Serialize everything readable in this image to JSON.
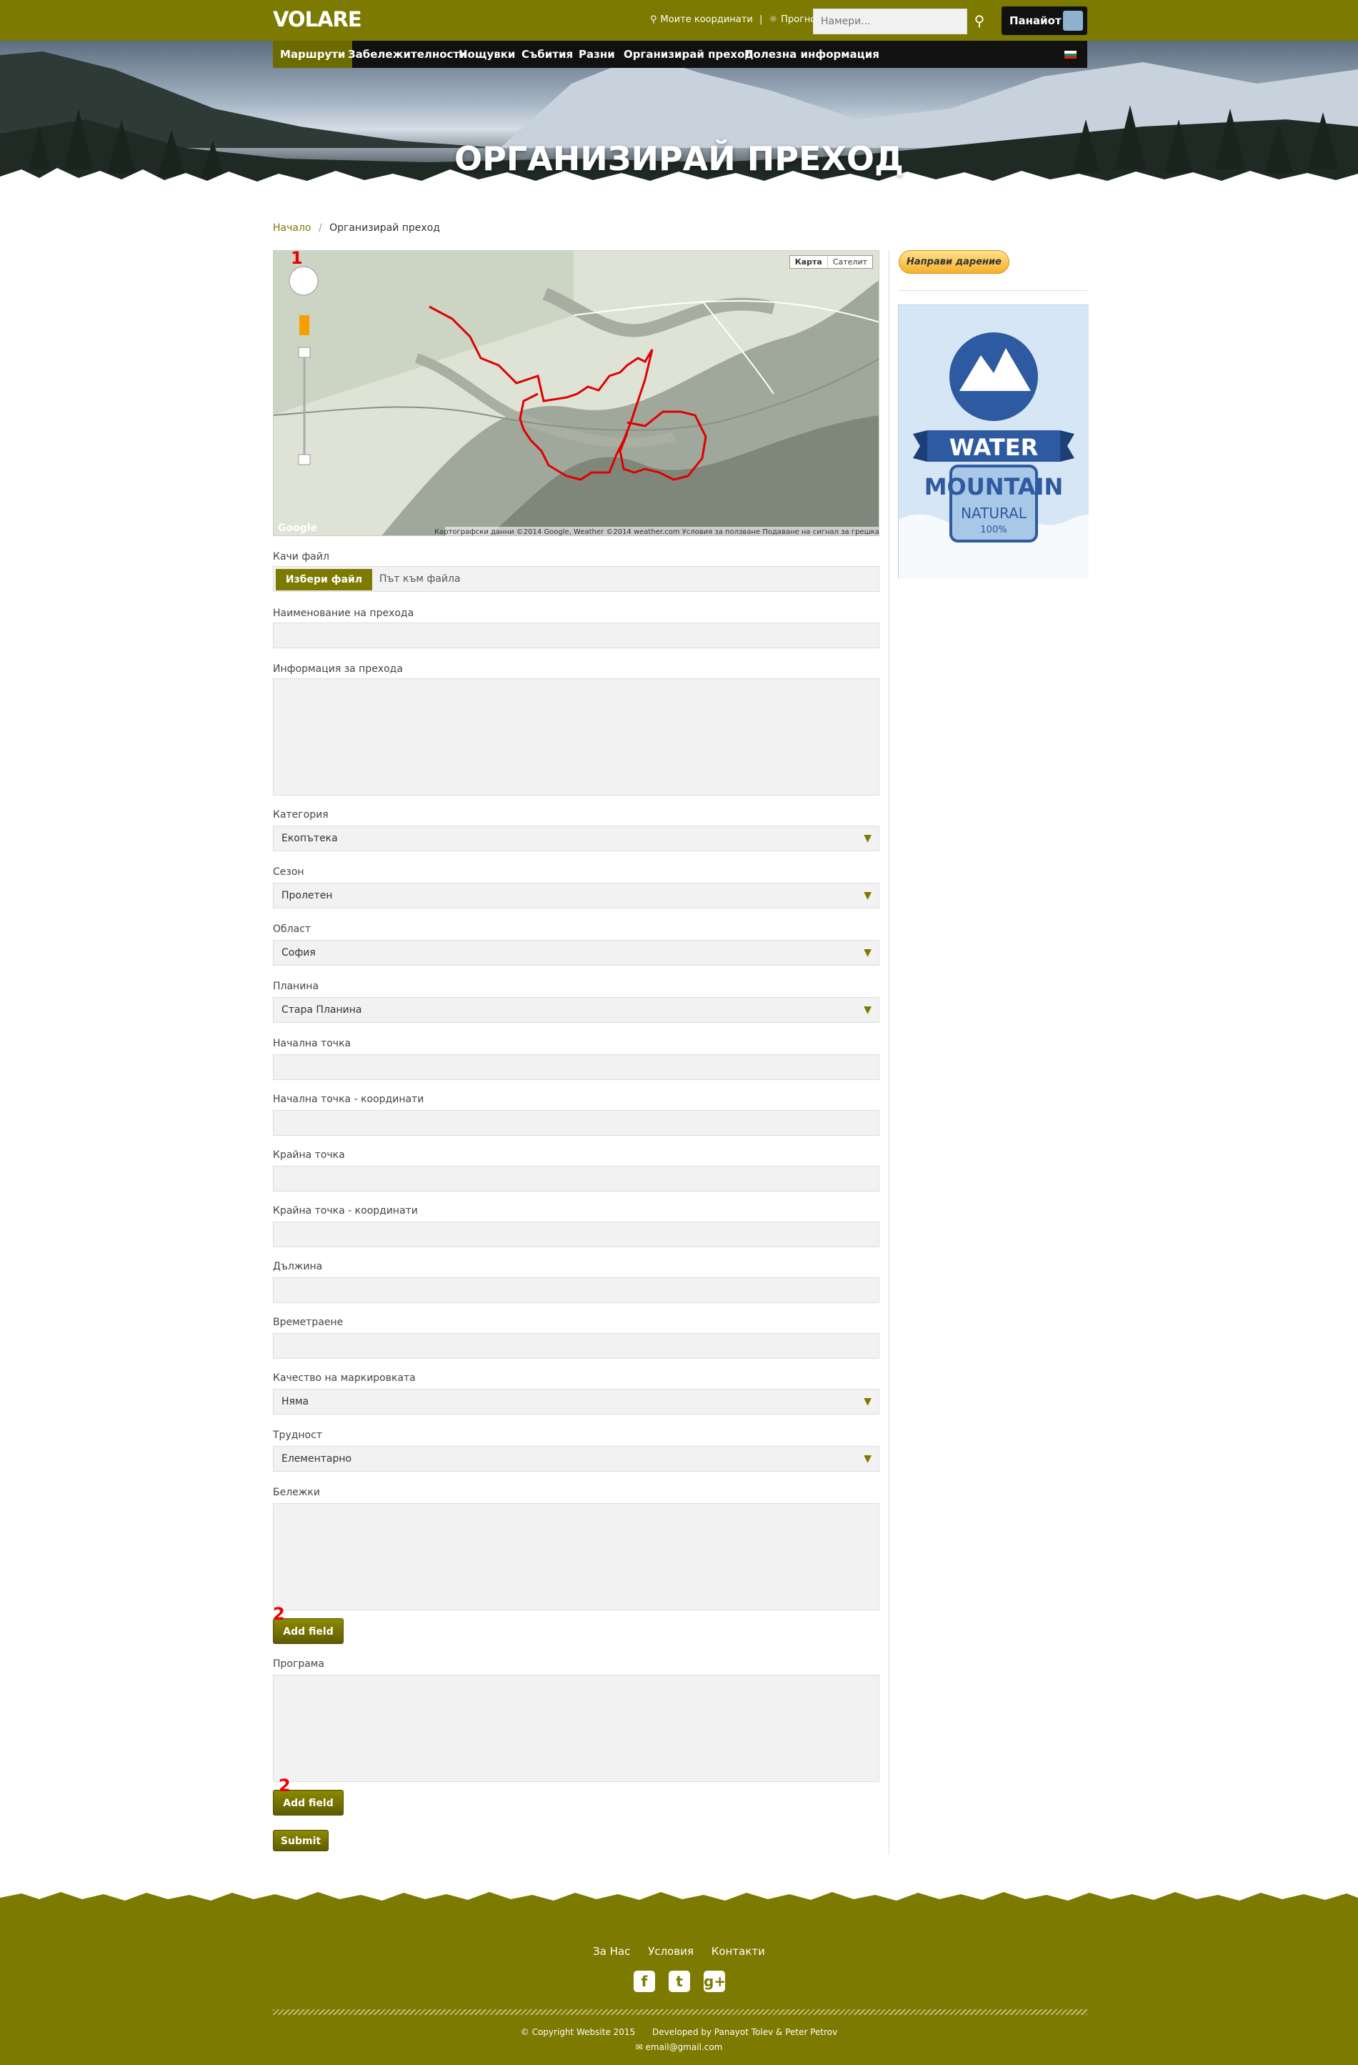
{
  "header": {
    "logo": "VOLARE",
    "coords_link": "Моите координати",
    "separator": "|",
    "forecast_link": "Прогноза",
    "search_placeholder": "Намери...",
    "user_name": "Панайот"
  },
  "nav": {
    "items": [
      "Маршрути",
      "Забележителности",
      "Нощувки",
      "Събития",
      "Разни",
      "Организирай преход",
      "Полезна информация"
    ],
    "active_index": 0
  },
  "hero": {
    "title": "ОРГАНИЗИРАЙ ПРЕХОД"
  },
  "breadcrumb": {
    "home": "Начало",
    "sep": "/",
    "current": "Организирай преход"
  },
  "map": {
    "type_buttons": [
      "Карта",
      "Сателит"
    ],
    "marker": "1",
    "google": "Google",
    "attribution": "Картографски данни ©2014 Google, Weather ©2014 weather.com   Условия за ползване   Подаване на сигнал за грешка в картата"
  },
  "form": {
    "upload_label": "Качи файл",
    "upload_button": "Избери файл",
    "upload_path": "Път към файла",
    "name_label": "Наименование на прехода",
    "info_label": "Информация за прехода",
    "category_label": "Категория",
    "category_value": "Екопътека",
    "season_label": "Сезон",
    "season_value": "Пролетен",
    "region_label": "Област",
    "region_value": "София",
    "mountain_label": "Планина",
    "mountain_value": "Стара Планина",
    "start_label": "Начална точка",
    "start_coords_label": "Начална точка - координати",
    "end_label": "Крайна точка",
    "end_coords_label": "Крайна точка - координати",
    "length_label": "Дължина",
    "duration_label": "Времетраене",
    "marking_label": "Качество на маркировката",
    "marking_value": "Няма",
    "difficulty_label": "Трудност",
    "difficulty_value": "Елементарно",
    "notes_label": "Бележки",
    "add_field_1": "Add field",
    "marker_2a": "2",
    "program_label": "Програма",
    "add_field_2": "Add field",
    "marker_2b": "2",
    "submit": "Submit"
  },
  "sidebar": {
    "donate": "Направи дарение",
    "ad_line1": "WATER",
    "ad_line2": "MOUNTAIN",
    "ad_line3": "NATURAL",
    "ad_line4": "100%"
  },
  "footer": {
    "links": [
      "За Нас",
      "Условия",
      "Контакти"
    ],
    "copyright": "© Copyright Website 2015",
    "developed": "Developed by Panayot Tolev & Peter Petrov",
    "email": "email@gmail.com"
  },
  "colors": {
    "brand": "#7c7a00",
    "route": "#e00000"
  }
}
